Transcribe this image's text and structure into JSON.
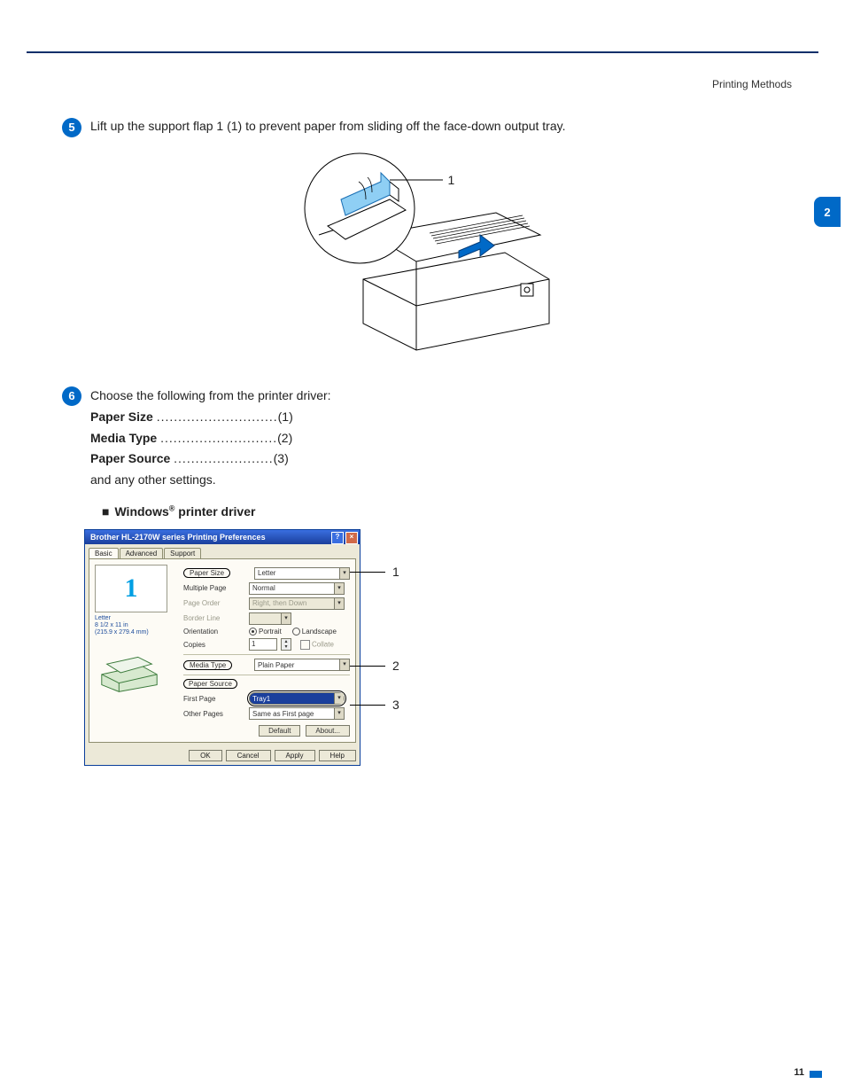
{
  "header": {
    "section": "Printing Methods"
  },
  "sideTab": "2",
  "pageNumber": "11",
  "step5": {
    "bullet": "5",
    "text": "Lift up the support flap 1 (1) to prevent paper from sliding off the face-down output tray.",
    "callout1": "1"
  },
  "step6": {
    "bullet": "6",
    "intro": "Choose the following from the printer driver:",
    "settings": [
      {
        "name": "Paper Size",
        "num": "(1)"
      },
      {
        "name": "Media Type",
        "num": "(2)"
      },
      {
        "name": "Paper Source",
        "num": "(3)"
      }
    ],
    "outro": "and any other settings.",
    "subhead": {
      "square": "■",
      "text1": "Windows",
      "sup": "®",
      "text2": " printer driver"
    }
  },
  "dialog": {
    "title": "Brother HL-2170W series Printing Preferences",
    "tabs": [
      "Basic",
      "Advanced",
      "Support"
    ],
    "activeTab": 0,
    "previewCaption": {
      "a": "Letter",
      "b": "8 1/2 x 11 in",
      "c": "(215.9 x 279.4 mm)"
    },
    "fields": {
      "paperSize": {
        "label": "Paper Size",
        "value": "Letter"
      },
      "multiplePage": {
        "label": "Multiple Page",
        "value": "Normal"
      },
      "pageOrder": {
        "label": "Page Order",
        "value": "Right, then Down"
      },
      "borderLine": {
        "label": "Border Line",
        "value": ""
      },
      "orientation": {
        "label": "Orientation",
        "portrait": "Portrait",
        "landscape": "Landscape"
      },
      "copies": {
        "label": "Copies",
        "value": "1",
        "collate": "Collate"
      },
      "mediaType": {
        "label": "Media Type",
        "value": "Plain Paper"
      },
      "paperSourceGroup": "Paper Source",
      "firstPage": {
        "label": "First Page",
        "value": "Tray1"
      },
      "otherPages": {
        "label": "Other Pages",
        "value": "Same as First page"
      }
    },
    "innerButtons": {
      "default": "Default",
      "about": "About..."
    },
    "outerButtons": {
      "ok": "OK",
      "cancel": "Cancel",
      "apply": "Apply",
      "help": "Help"
    }
  },
  "screenshotLeaders": {
    "n1": "1",
    "n2": "2",
    "n3": "3"
  }
}
